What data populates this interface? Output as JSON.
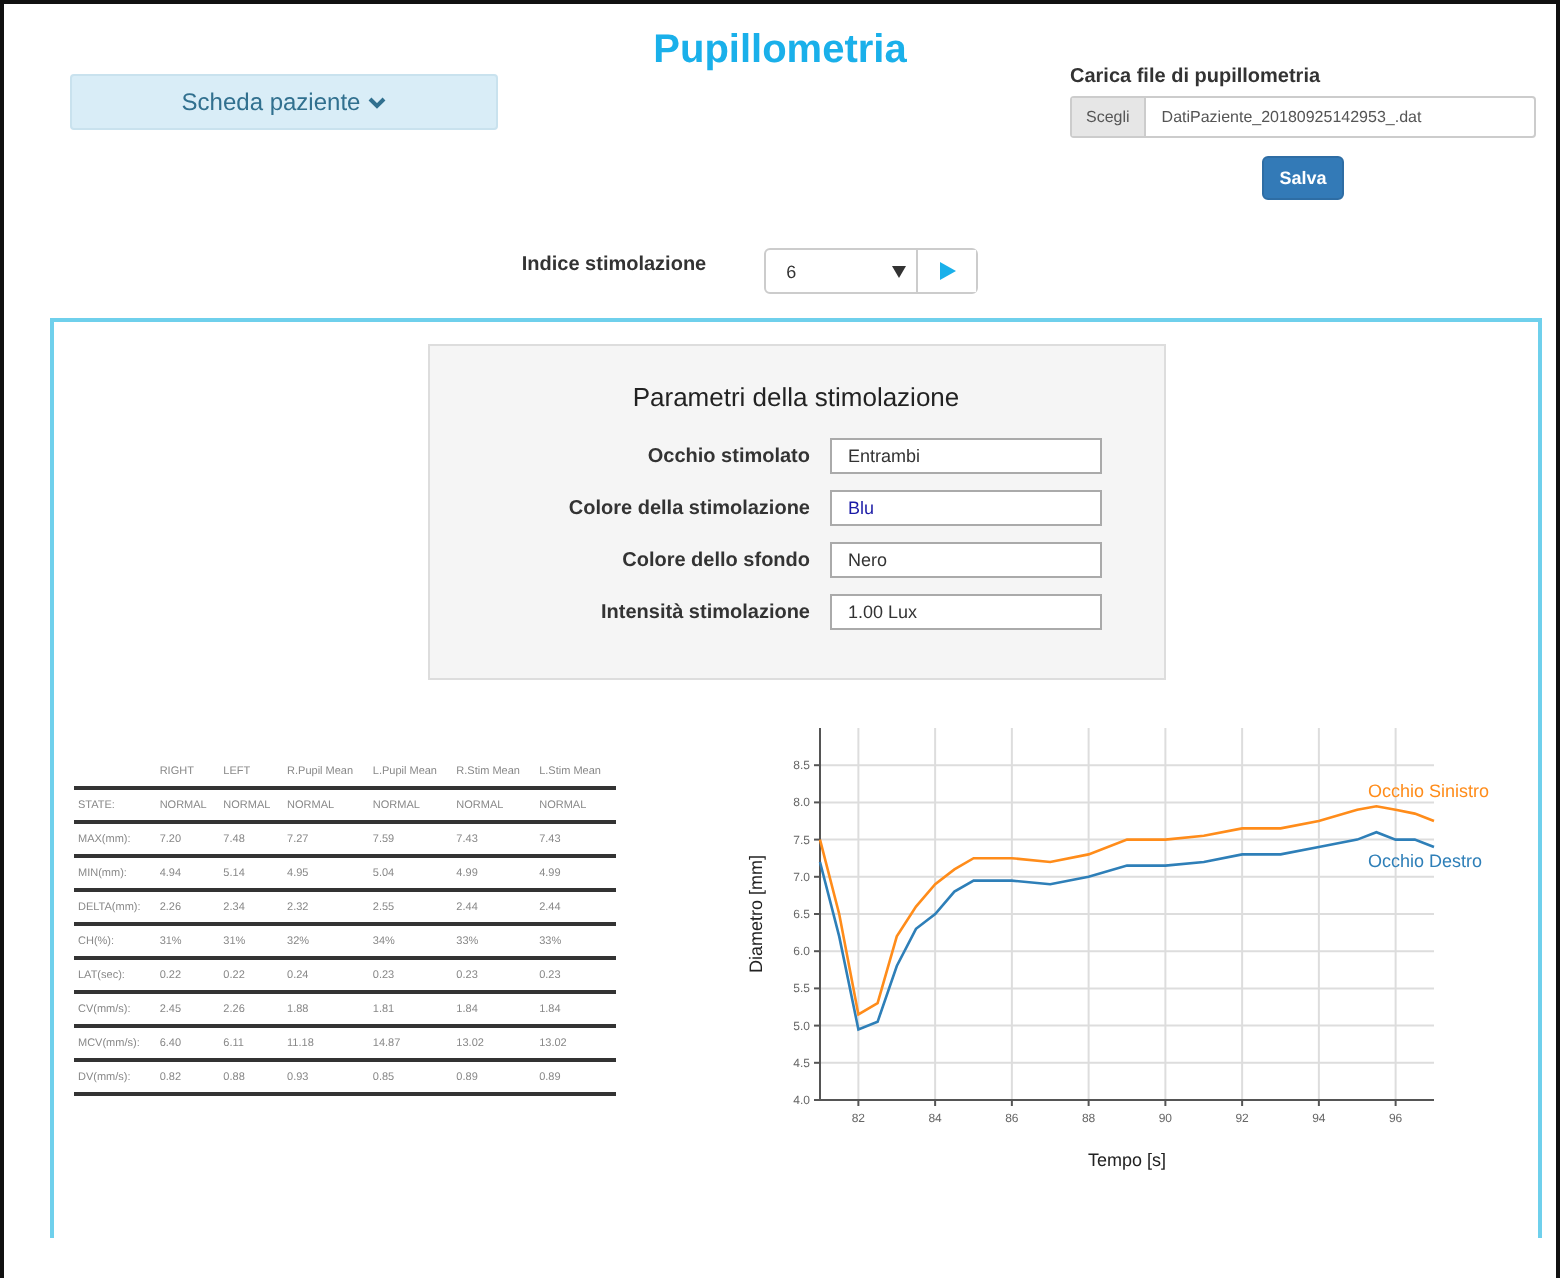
{
  "title": "Pupillometria",
  "patient_card_button": {
    "label": "Scheda paziente"
  },
  "file_upload": {
    "label": "Carica file di pupillometria",
    "button": "Scegli",
    "filename": "DatiPaziente_20180925142953_.dat"
  },
  "save_button": {
    "label": "Salva"
  },
  "stimulation_index": {
    "label": "Indice stimolazione",
    "value": "6"
  },
  "parameters": {
    "title": "Parametri della stimolazione",
    "fields": [
      {
        "label": "Occhio stimolato",
        "value": "Entrambi",
        "color": "#333333"
      },
      {
        "label": "Colore della stimolazione",
        "value": "Blu",
        "color": "#1a1aa6"
      },
      {
        "label": "Colore dello sfondo",
        "value": "Nero",
        "color": "#333333"
      },
      {
        "label": "Intensità stimolazione",
        "value": "1.00 Lux",
        "color": "#333333"
      }
    ]
  },
  "table": {
    "columns": [
      "",
      "RIGHT",
      "LEFT",
      "R.Pupil Mean",
      "L.Pupil Mean",
      "R.Stim Mean",
      "L.Stim Mean"
    ],
    "rows": [
      [
        "STATE:",
        "NORMAL",
        "NORMAL",
        "NORMAL",
        "NORMAL",
        "NORMAL",
        "NORMAL"
      ],
      [
        "MAX(mm):",
        "7.20",
        "7.48",
        "7.27",
        "7.59",
        "7.43",
        "7.43"
      ],
      [
        "MIN(mm):",
        "4.94",
        "5.14",
        "4.95",
        "5.04",
        "4.99",
        "4.99"
      ],
      [
        "DELTA(mm):",
        "2.26",
        "2.34",
        "2.32",
        "2.55",
        "2.44",
        "2.44"
      ],
      [
        "CH(%):",
        "31%",
        "31%",
        "32%",
        "34%",
        "33%",
        "33%"
      ],
      [
        "LAT(sec):",
        "0.22",
        "0.22",
        "0.24",
        "0.23",
        "0.23",
        "0.23"
      ],
      [
        "CV(mm/s):",
        "2.45",
        "2.26",
        "1.88",
        "1.81",
        "1.84",
        "1.84"
      ],
      [
        "MCV(mm/s):",
        "6.40",
        "6.11",
        "11.18",
        "14.87",
        "13.02",
        "13.02"
      ],
      [
        "DV(mm/s):",
        "0.82",
        "0.88",
        "0.93",
        "0.85",
        "0.89",
        "0.89"
      ]
    ]
  },
  "chart": {
    "chart_data": {
      "type": "line",
      "xlabel": "Tempo [s]",
      "ylabel": "Diametro [mm]",
      "x": [
        81,
        81.5,
        82,
        82.5,
        83,
        83.5,
        84,
        84.5,
        85,
        86,
        87,
        88,
        89,
        90,
        91,
        92,
        93,
        94,
        95,
        95.5,
        96,
        96.5,
        97
      ],
      "series": [
        {
          "name": "Occhio Sinistro",
          "color": "#ff8c1a",
          "values": [
            7.5,
            6.5,
            5.15,
            5.3,
            6.2,
            6.6,
            6.9,
            7.1,
            7.25,
            7.25,
            7.2,
            7.3,
            7.5,
            7.5,
            7.55,
            7.65,
            7.65,
            7.75,
            7.9,
            7.95,
            7.9,
            7.85,
            7.75
          ]
        },
        {
          "name": "Occhio Destro",
          "color": "#2e7fb8",
          "values": [
            7.2,
            6.2,
            4.95,
            5.05,
            5.8,
            6.3,
            6.5,
            6.8,
            6.95,
            6.95,
            6.9,
            7.0,
            7.15,
            7.15,
            7.2,
            7.3,
            7.3,
            7.4,
            7.5,
            7.6,
            7.5,
            7.5,
            7.4
          ]
        }
      ],
      "grid": true,
      "xlim": [
        81,
        97
      ],
      "ylim": [
        4,
        9
      ],
      "xticks": [
        82,
        84,
        86,
        88,
        90,
        92,
        94,
        96
      ],
      "yticks": [
        {
          "value": 4,
          "label": "4.0"
        },
        {
          "value": 4.5,
          "label": "4.5"
        },
        {
          "value": 5,
          "label": "5.0"
        },
        {
          "value": 5.5,
          "label": "5.5"
        },
        {
          "value": 6,
          "label": "6.0"
        },
        {
          "value": 6.5,
          "label": "6.5"
        },
        {
          "value": 7,
          "label": "7.0"
        },
        {
          "value": 7.5,
          "label": "7.5"
        },
        {
          "value": 8,
          "label": "8.0"
        },
        {
          "value": 8.5,
          "label": "8.5"
        }
      ]
    }
  }
}
